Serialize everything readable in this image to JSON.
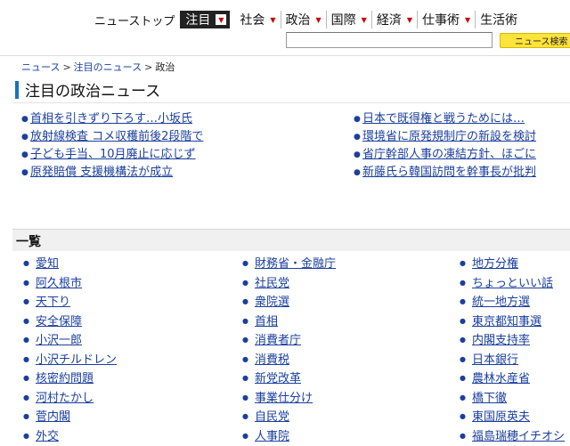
{
  "nav": {
    "home": "ニューストップ",
    "tabs": [
      {
        "label": "注目",
        "active": true
      },
      {
        "label": "社会",
        "active": false
      },
      {
        "label": "政治",
        "active": false
      },
      {
        "label": "国際",
        "active": false
      },
      {
        "label": "経済",
        "active": false
      },
      {
        "label": "仕事術",
        "active": false
      },
      {
        "label": "生活術",
        "active": false
      }
    ]
  },
  "search": {
    "value": "",
    "button": "ニュース検索"
  },
  "breadcrumb": [
    "ニュース",
    "注目のニュース",
    "政治"
  ],
  "page_title": "注目の政治ニュース",
  "news_left": [
    "首相を引きずり下ろす…小坂氏",
    "放射線検査 コメ収穫前後2段階で",
    "子ども手当、10月廃止に応じず",
    "原発賠償 支援機構法が成立"
  ],
  "news_right": [
    "日本で既得権と戦うためには…",
    "環境省に原発規制庁の新設を検討",
    "省庁幹部人事の凍結方針、ほごに",
    "新藤氏ら韓国訪問を幹事長が批判"
  ],
  "list_title": "一覧",
  "categories": {
    "col1": [
      "愛知",
      "阿久根市",
      "天下り",
      "安全保障",
      "小沢一郎",
      "小沢チルドレン",
      "核密約問題",
      "河村たかし",
      "菅内閣",
      "外交"
    ],
    "col2": [
      "財務省・金融庁",
      "社民党",
      "衆院選",
      "首相",
      "消費者庁",
      "消費税",
      "新党改革",
      "事業仕分け",
      "自民党",
      "人事院"
    ],
    "col3": [
      "地方分権",
      "ちょっといい話",
      "統一地方選",
      "東京都知事選",
      "内閣支持率",
      "日本銀行",
      "農林水産省",
      "橋下徹",
      "東国原英夫",
      "福島瑞穂イチオシ"
    ]
  },
  "colors": {
    "link": "#1a3f9e",
    "accent": "#c00000",
    "search_button": "#fde33a",
    "heading_bar": "#1a6fc0"
  }
}
